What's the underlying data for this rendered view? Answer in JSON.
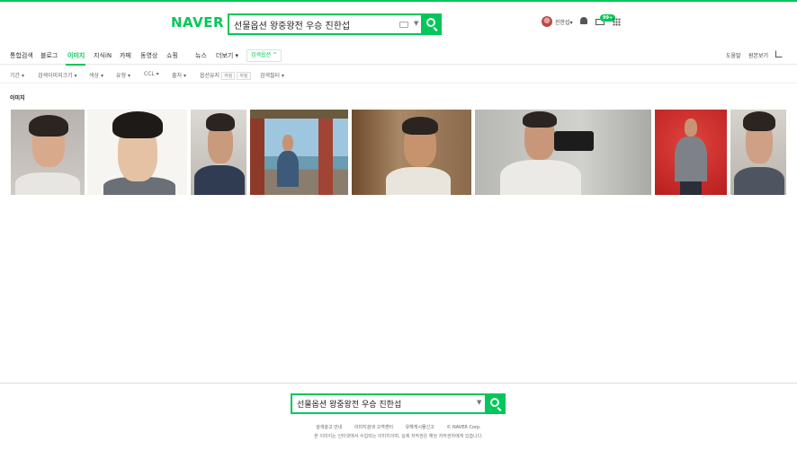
{
  "brand": {
    "logo": "NAVER",
    "accent": "#03c75a"
  },
  "search": {
    "query": "선물옵션 왕중왕전 우승 진한섭"
  },
  "user": {
    "name": "진한섭",
    "mail_badge": "99+"
  },
  "icons": [
    "keyboard-icon",
    "search-icon",
    "bell-icon",
    "mail-icon",
    "apps-grid-icon",
    "share-icon"
  ],
  "tabs": [
    "통합검색",
    "블로그",
    "이미지",
    "지식iN",
    "카페",
    "동영상",
    "쇼핑",
    "뉴스",
    "더보기"
  ],
  "active_tab": "이미지",
  "search_option": "검색옵션",
  "right_links": [
    "도움말",
    "원본보기"
  ],
  "filters": {
    "period": "기간",
    "size": "검색이미지크기",
    "color": "색상",
    "type": "유형",
    "ccl": "CCL",
    "source": "출처",
    "option": "옵션유지",
    "chip_on": "켜짐",
    "chip_off": "꺼짐",
    "search_filter": "검색필터"
  },
  "section_title": "이미지",
  "images": [
    "portrait-selfie-1",
    "portrait-cartoon",
    "portrait-selfie-2",
    "photo-outdoor-pavilion",
    "photo-indoor-seated",
    "photo-mirror-selfie",
    "photo-red-background",
    "portrait-selfie-3"
  ],
  "footer": {
    "query": "선물옵션 왕중왕전 우승 진한섭",
    "links": [
      "검색광고 안내",
      "이미지검색 고객센터",
      "유해게시물신고",
      "© NAVER Corp."
    ],
    "note": "본 이미지는 인터넷에서 수집되는 이미지이며, 실제 저작권은 해당 저작권자에게 있습니다."
  }
}
